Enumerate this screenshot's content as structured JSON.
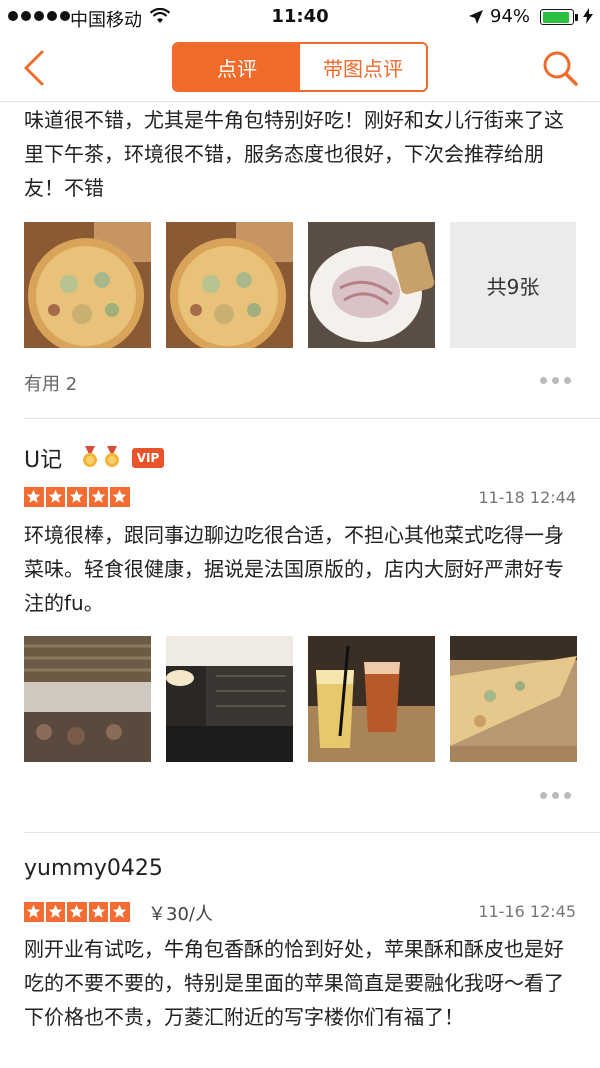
{
  "status_bar": {
    "carrier": "中国移动",
    "time": "11:40",
    "battery": "94%",
    "battery_level": 0.94
  },
  "nav": {
    "tabs": [
      {
        "label": "点评",
        "active": true
      },
      {
        "label": "带图点评",
        "active": false
      }
    ],
    "accent_color": "#f06a2a"
  },
  "reviews": [
    {
      "text": "味道很不错，尤其是牛角包特别好吃！刚好和女儿行街来了这里下午茶，环境很不错，服务态度也很好，下次会推荐给朋友！不错",
      "photos": [
        "pizza-photo",
        "pizza-photo",
        "pasta-photo"
      ],
      "more_photos": "共9张",
      "useful": "有用 2"
    },
    {
      "user": "U记",
      "vip": "VIP",
      "rating": 5,
      "date": "11-18 12:44",
      "text": "环境很棒，跟同事边聊边吃很合适，不担心其他菜式吃得一身菜味。轻食很健康，据说是法国原版的，店内大厨好严肃好专注的fu。",
      "photos": [
        "restaurant-interior-photo",
        "restaurant-interior-photo",
        "drinks-photo",
        "pizza-slice-photo"
      ]
    },
    {
      "user": "yummy0425",
      "rating": 5,
      "price": "￥30/人",
      "date": "11-16 12:45",
      "text": "刚开业有试吃，牛角包香酥的恰到好处，苹果酥和酥皮也是好吃的不要不要的，特别是里面的苹果简直是要融化我呀～看了下价格也不贵，万菱汇附近的写字楼你们有福了！"
    }
  ]
}
